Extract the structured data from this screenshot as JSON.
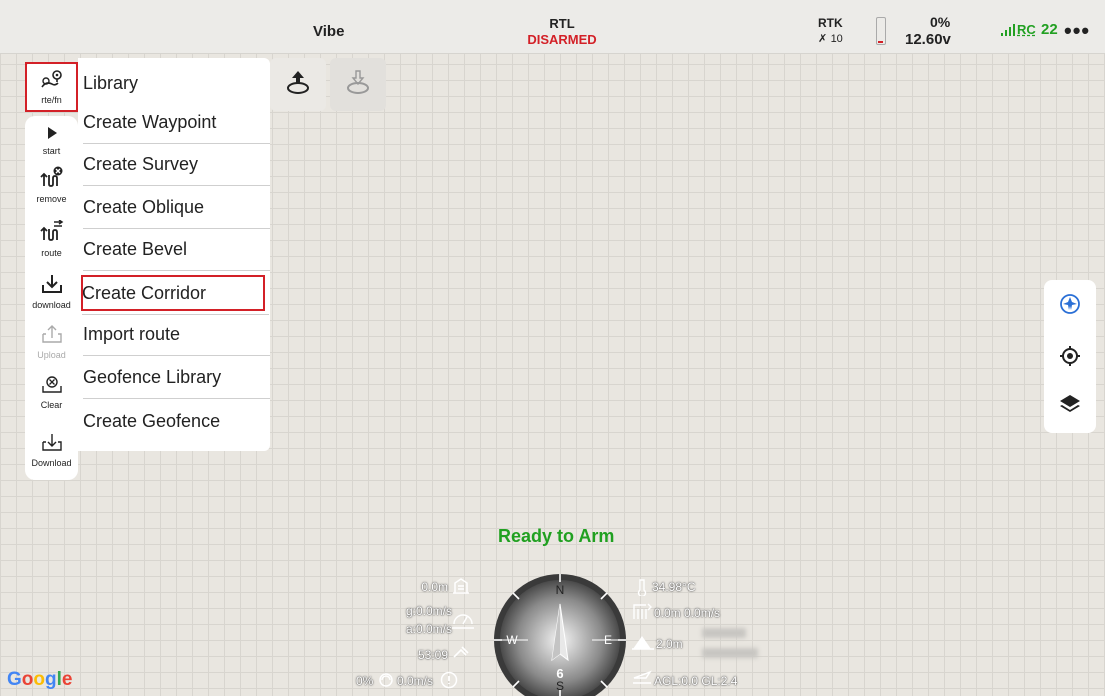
{
  "status_bar": {
    "vehicle_name": "Vibe",
    "flight_mode": "RTL",
    "arm_state": "DISARMED",
    "gps_label": "RTK",
    "satellites": "10",
    "battery_percent": "0%",
    "voltage": "12.60v",
    "rc_label": "RC",
    "rc_value": "22",
    "more": "•••"
  },
  "rail": {
    "rte_label": "rte/fn",
    "items": [
      {
        "label": "start"
      },
      {
        "label": "remove"
      },
      {
        "label": "route"
      },
      {
        "label": "download"
      },
      {
        "label": "Upload"
      },
      {
        "label": "Clear"
      },
      {
        "label": "Download"
      }
    ]
  },
  "menu": {
    "items": [
      {
        "label": "Library"
      },
      {
        "label": "Create Waypoint"
      },
      {
        "label": "Create Survey"
      },
      {
        "label": "Create Oblique"
      },
      {
        "label": "Create Bevel"
      },
      {
        "label": "Create Corridor"
      },
      {
        "label": "Import route"
      },
      {
        "label": "Geofence Library"
      },
      {
        "label": "Create Geofence"
      }
    ]
  },
  "telemetry": {
    "status": "Ready to Arm",
    "altitude": "0.0m",
    "ground_speed": "g:0.0m/s",
    "air_speed": "a:0.0m/s",
    "flight_time": "53:09",
    "throttle": "0%",
    "wind_speed": "0.0m/s",
    "temperature": "34.98°C",
    "climb": "0.0m 0.0m/s",
    "distance": "2.0m",
    "agl": "AGL:0.0 GL:2.4",
    "compass_heading": "6",
    "compass_n": "N",
    "compass_s": "S",
    "compass_e": "E",
    "compass_w": "W"
  },
  "map": {
    "attribution": [
      "G",
      "o",
      "o",
      "g",
      "l",
      "e"
    ]
  },
  "colors": {
    "accent_red": "#d32027",
    "ready_green": "#20a020",
    "rc_green": "#22a022",
    "right_controls_blue": "#2a6fd6"
  }
}
